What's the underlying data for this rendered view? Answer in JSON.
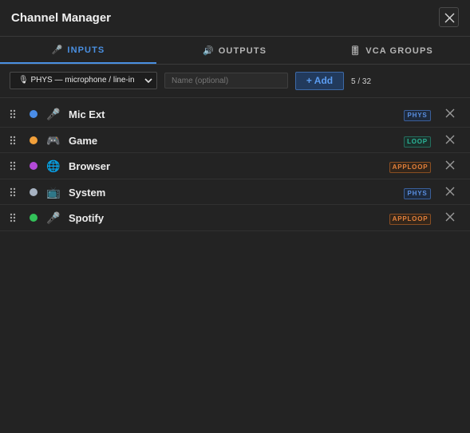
{
  "window": {
    "title": "Channel Manager"
  },
  "tabs": [
    {
      "label": "INPUTS",
      "icon": "microphone-icon",
      "glyph": "🎤",
      "active": true
    },
    {
      "label": "OUTPUTS",
      "icon": "speaker-icon",
      "glyph": "🔊",
      "active": false
    },
    {
      "label": "VCA GROUPS",
      "icon": "fader-icon",
      "glyph": "🎚",
      "active": false
    }
  ],
  "toolbar": {
    "source_select": {
      "value": "🎙 PHYS — microphone / line-in"
    },
    "name_input": {
      "placeholder": "Name (optional)",
      "value": ""
    },
    "add_label": "+ Add",
    "count": "5 / 32"
  },
  "channels": [
    {
      "name": "Mic Ext",
      "color": "#4a8de8",
      "icon": "microphone-icon",
      "glyph": "🎤",
      "badge": "PHYS",
      "badge_type": "phys"
    },
    {
      "name": "Game",
      "color": "#f2a03a",
      "icon": "gamepad-icon",
      "glyph": "🎮",
      "badge": "LOOP",
      "badge_type": "loop"
    },
    {
      "name": "Browser",
      "color": "#b44ad8",
      "icon": "globe-icon",
      "glyph": "🌐",
      "badge": "APPLOOP",
      "badge_type": "apploop"
    },
    {
      "name": "System",
      "color": "#a7b3c2",
      "icon": "tv-icon",
      "glyph": "📺",
      "badge": "PHYS",
      "badge_type": "phys"
    },
    {
      "name": "Spotify",
      "color": "#33c25a",
      "icon": "microphone-icon",
      "glyph": "🎤",
      "badge": "APPLOOP",
      "badge_type": "apploop"
    }
  ]
}
